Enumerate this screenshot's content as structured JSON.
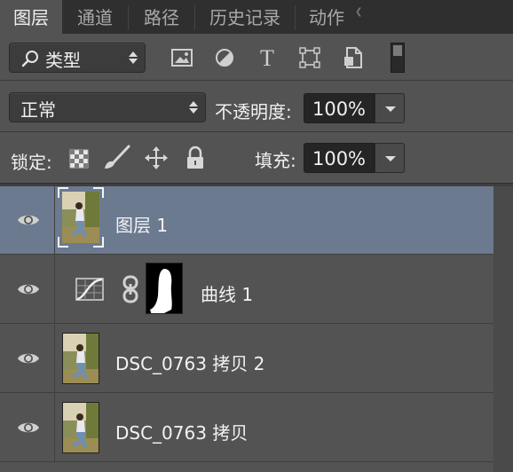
{
  "tabs": [
    {
      "label": "图层",
      "active": true
    },
    {
      "label": "通道",
      "active": false
    },
    {
      "label": "路径",
      "active": false
    },
    {
      "label": "历史记录",
      "active": false
    },
    {
      "label": "动作",
      "active": false
    }
  ],
  "filter": {
    "kind_label": "类型",
    "icons": [
      "image-filter-icon",
      "adjustment-filter-icon",
      "type-filter-icon",
      "shape-filter-icon",
      "smart-object-filter-icon",
      "filter-toggle-icon"
    ]
  },
  "blend": {
    "mode": "正常",
    "opacity_label": "不透明度:",
    "opacity_value": "100%"
  },
  "lock": {
    "label": "锁定:",
    "fill_label": "填充:",
    "fill_value": "100%",
    "icons": [
      "lock-transparent-pixels-icon",
      "lock-image-pixels-icon",
      "lock-position-icon",
      "lock-all-icon"
    ]
  },
  "layers": [
    {
      "name": "图层 1",
      "type": "pixel",
      "selected": true
    },
    {
      "name": "曲线 1",
      "type": "curves-adjustment",
      "selected": false
    },
    {
      "name": "DSC_0763 拷贝 2",
      "type": "pixel",
      "selected": false
    },
    {
      "name": "DSC_0763 拷贝",
      "type": "pixel",
      "selected": false
    }
  ],
  "colors": {
    "panel": "#535353",
    "selected_row": "#6c7a90",
    "tab_bar": "#2f2f2f"
  }
}
